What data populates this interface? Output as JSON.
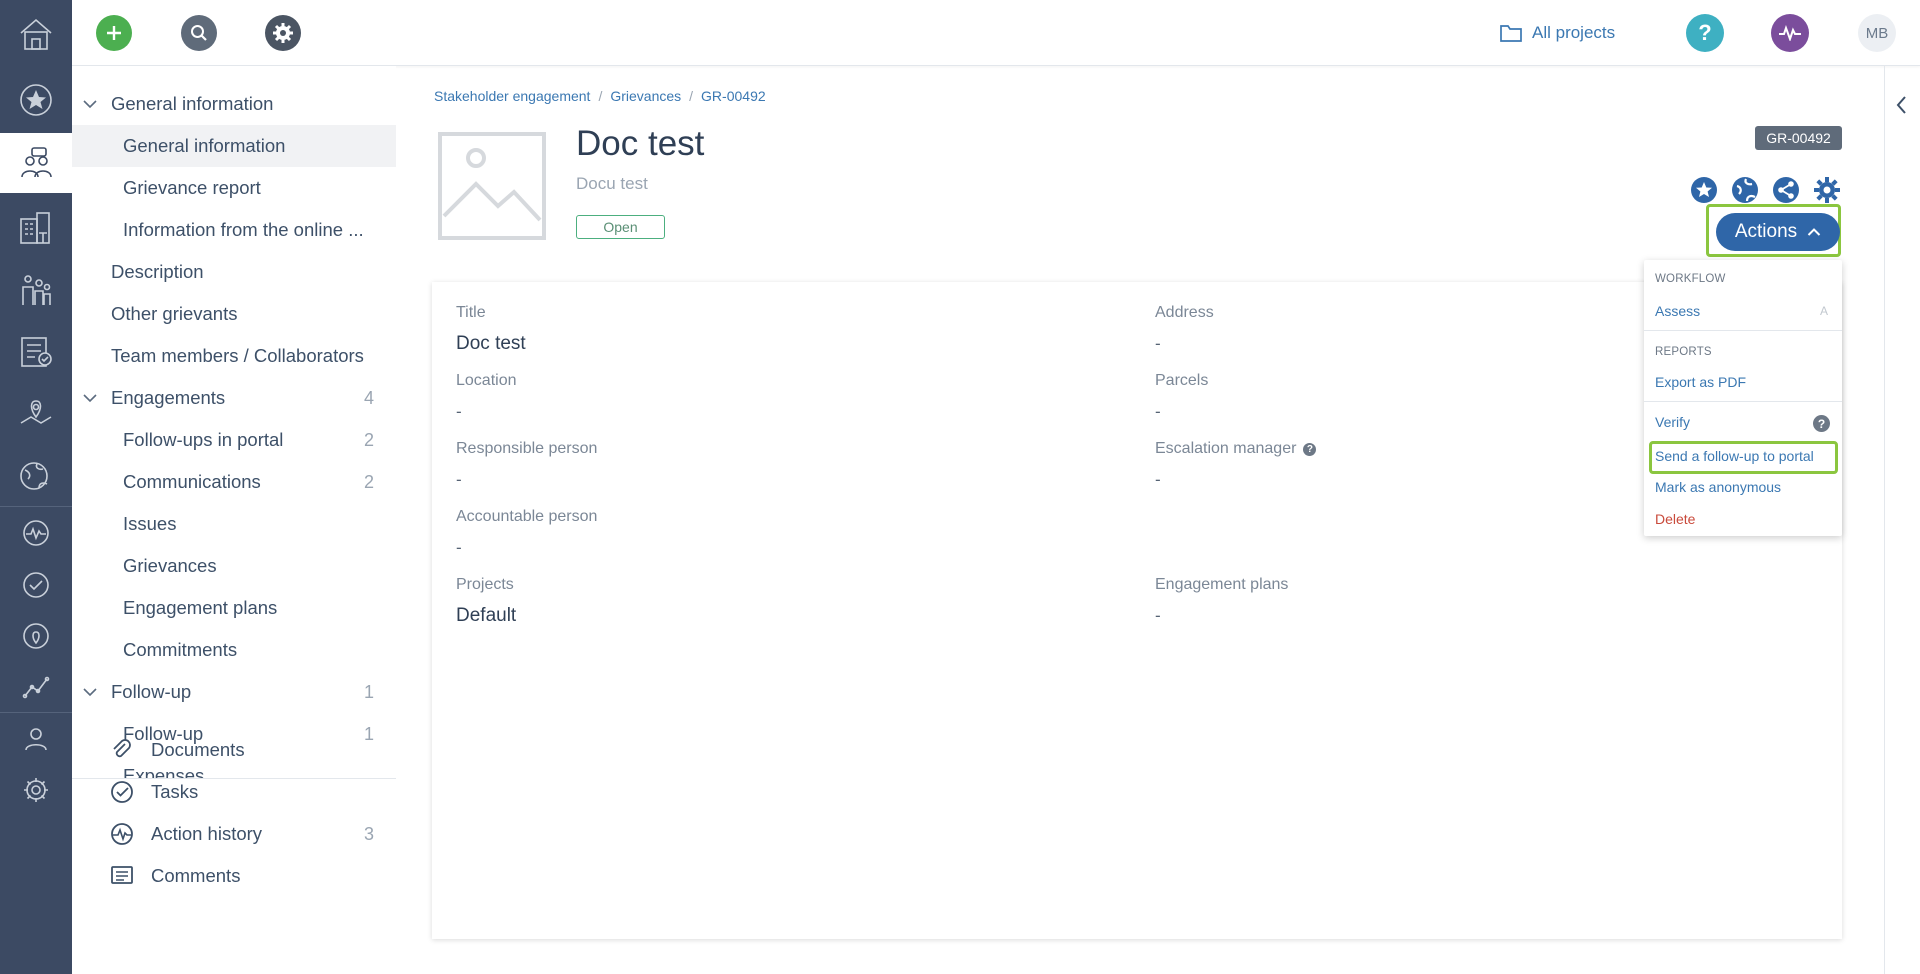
{
  "topbar": {
    "add_icon": "plus-icon",
    "search_icon": "search-icon",
    "settings_icon": "gear-icon",
    "all_projects": "All projects",
    "help_icon": "question-icon",
    "activity_icon": "pulse-icon",
    "avatar": "MB"
  },
  "rail": {
    "items": [
      "home-icon",
      "star-icon",
      "stakeholder-icon",
      "buildings-icon",
      "people-icon",
      "checklist-icon",
      "map-pin-icon",
      "globe-icon",
      "pulse-icon",
      "check-icon",
      "location-icon",
      "graph-icon",
      "user-icon",
      "gear-icon"
    ]
  },
  "sidenav": {
    "items": [
      {
        "label": "General information",
        "level": 1,
        "chevron": true
      },
      {
        "label": "General information",
        "level": 2,
        "selected": true
      },
      {
        "label": "Grievance report",
        "level": 2
      },
      {
        "label": "Information from the online ...",
        "level": 2
      },
      {
        "label": "Description",
        "level": 1
      },
      {
        "label": "Other grievants",
        "level": 1
      },
      {
        "label": "Team members / Collaborators",
        "level": 1
      },
      {
        "label": "Engagements",
        "level": 1,
        "chevron": true,
        "count": "4"
      },
      {
        "label": "Follow-ups in portal",
        "level": 2,
        "count": "2"
      },
      {
        "label": "Communications",
        "level": 2,
        "count": "2"
      },
      {
        "label": "Issues",
        "level": 2
      },
      {
        "label": "Grievances",
        "level": 2
      },
      {
        "label": "Engagement plans",
        "level": 2
      },
      {
        "label": "Commitments",
        "level": 2
      },
      {
        "label": "Follow-up",
        "level": 1,
        "chevron": true,
        "count": "1"
      },
      {
        "label": "Follow-up",
        "level": 2,
        "count": "1"
      },
      {
        "label": "Expenses",
        "level": 2
      }
    ],
    "bottom": [
      {
        "label": "Documents",
        "icon": "paperclip-icon"
      },
      {
        "label": "Tasks",
        "icon": "check-circle-icon"
      },
      {
        "label": "Action history",
        "icon": "pulse-icon",
        "count": "3"
      },
      {
        "label": "Comments",
        "icon": "comment-icon"
      }
    ]
  },
  "breadcrumb": [
    "Stakeholder engagement",
    "Grievances",
    "GR-00492"
  ],
  "breadcrumb_sep": "/",
  "header": {
    "title": "Doc test",
    "subtitle": "Docu test",
    "status": "Open",
    "id": "GR-00492",
    "actions_label": "Actions"
  },
  "fields": {
    "title_label": "Title",
    "title_value": "Doc test",
    "address_label": "Address",
    "address_value": "-",
    "location_label": "Location",
    "location_value": "-",
    "parcels_label": "Parcels",
    "parcels_value": "-",
    "responsible_label": "Responsible person",
    "responsible_value": "-",
    "escalation_label": "Escalation manager",
    "escalation_value": "-",
    "accountable_label": "Accountable person",
    "accountable_value": "-",
    "projects_label": "Projects",
    "projects_value": "Default",
    "plans_label": "Engagement plans",
    "plans_value": "-"
  },
  "dropdown": {
    "workflow_head": "WORKFLOW",
    "assess": "Assess",
    "assess_shortcut": "A",
    "reports_head": "REPORTS",
    "export_pdf": "Export as PDF",
    "verify": "Verify",
    "send_followup": "Send a follow-up to portal",
    "mark_anonymous": "Mark as anonymous",
    "delete": "Delete"
  },
  "colors": {
    "rail_bg": "#3c4a63",
    "accent_blue": "#2f66a8",
    "link_blue": "#3b78b2",
    "highlight_green": "#8bc63f",
    "add_green": "#4caf50"
  }
}
